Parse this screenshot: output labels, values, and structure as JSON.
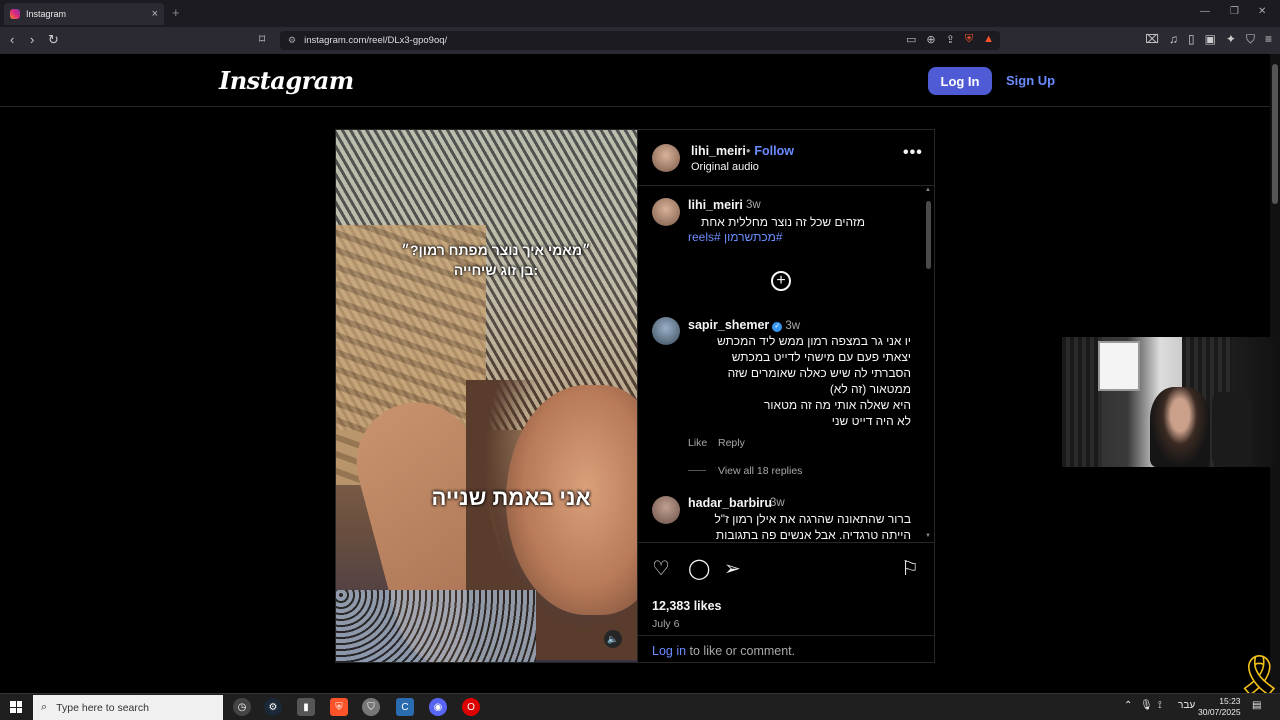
{
  "browser": {
    "tab_title": "Instagram",
    "url": "instagram.com/reel/DLx3-gpo9oq/",
    "new_tab_symbol": "+",
    "close_symbol": "×"
  },
  "header": {
    "logo": "Instagram",
    "login_label": "Log In",
    "signup_label": "Sign Up"
  },
  "media": {
    "caption_top_line1": "״מאמי איך נוצר מפתח רמון?״",
    "caption_top_line2": "בן זוג שיחייה:",
    "caption_mid": "אני באמת שנייה"
  },
  "post": {
    "author": "lihi_meiri",
    "follow_label": "Follow",
    "separator": "•",
    "audio": "Original audio",
    "likes": "12,383 likes",
    "date": "July 6",
    "login_link": "Log in",
    "login_rest": " to like or comment."
  },
  "comments": [
    {
      "user": "lihi_meiri",
      "time": "3w",
      "text": "מזהים שכל זה נוצר מחללית אחת",
      "tags": "#מכתשרמון #reels"
    },
    {
      "user": "sapir_shemer",
      "time": "3w",
      "lines": [
        "יו אני גר במצפה רמון ממש ליד המכתש",
        "יצאתי פעם עם מישהי לדייט במכתש",
        "הסברתי לה שיש כאלה שאומרים שזה",
        "ממטאור (זה לא)",
        "היא שאלה אותי מה זה מטאור",
        "לא היה דייט שני"
      ],
      "like_label": "Like",
      "reply_label": "Reply",
      "view_replies": "View all 18 replies"
    },
    {
      "user": "hadar_barbiru",
      "time": "3w",
      "lines": [
        "ברור שהתאונה שהרגה את אילן רמון ז\"ל",
        "הייתה טרגדיה. אבל אנשים פה בתגובות"
      ]
    }
  ],
  "taskbar": {
    "search_placeholder": "Type here to search",
    "lang": "עבר",
    "time": "15:23",
    "date": "30/07/2025"
  },
  "colors": {
    "accent_blue": "#4f5bd5",
    "link_blue": "#6b8cff",
    "ribbon_yellow": "#f2c21b"
  }
}
